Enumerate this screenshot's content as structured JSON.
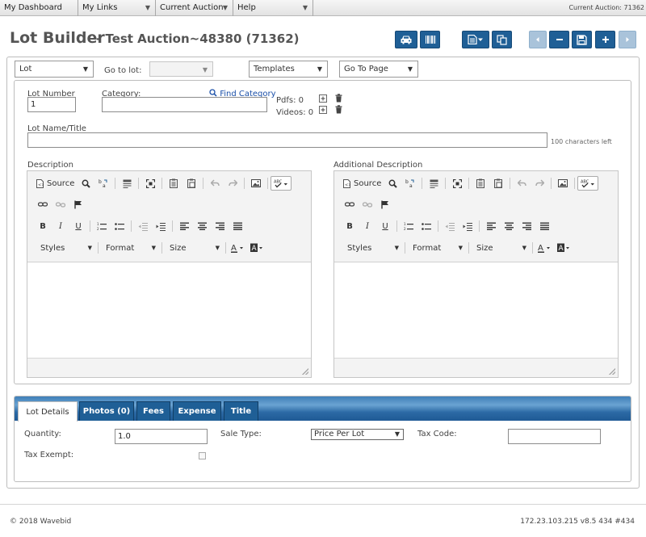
{
  "nav": {
    "items": [
      "My Dashboard",
      "My Links",
      "Current Auction",
      "Help"
    ],
    "current_auction_label": "Current Auction: 71362"
  },
  "header": {
    "title": "Lot Builder",
    "subtitle": "- Test Auction~48380 (71362)"
  },
  "toolbar_buttons": [
    "car-icon",
    "barcode-icon",
    "document-dropdown-icon",
    "copy-icon",
    "arrow-left-icon",
    "minus-icon",
    "save-icon",
    "plus-icon",
    "arrow-right-icon"
  ],
  "controls": {
    "lot_select": "Lot",
    "goto_label": "Go to lot:",
    "goto_value": "",
    "templates_select": "Templates",
    "goto_page_select": "Go To Page"
  },
  "form": {
    "lot_number_label": "Lot Number",
    "lot_number_value": "1",
    "category_label": "Category:",
    "category_value": "",
    "find_category": "Find Category",
    "pdfs_label": "Pdfs: 0",
    "videos_label": "Videos: 0",
    "lot_name_label": "Lot Name/Title",
    "lot_name_value": "",
    "chars_left": "100 characters left",
    "description_label": "Description",
    "additional_description_label": "Additional Description"
  },
  "editor": {
    "source": "Source",
    "styles": "Styles",
    "format": "Format",
    "size": "Size",
    "bold": "B",
    "italic": "I",
    "underline": "U"
  },
  "tabs": [
    "Lot Details",
    "Photos (0)",
    "Fees",
    "Expense",
    "Title"
  ],
  "details": {
    "quantity_label": "Quantity:",
    "quantity_value": "1.0",
    "sale_type_label": "Sale Type:",
    "sale_type_value": "Price Per Lot",
    "tax_code_label": "Tax Code:",
    "tax_code_value": "",
    "tax_exempt_label": "Tax Exempt:"
  },
  "footer": {
    "copyright": "© 2018 Wavebid",
    "version": "172.23.103.215  v8.5 434  #434"
  },
  "colors": {
    "primary": "#1f5f96",
    "primary_light": "#a9c3da"
  }
}
